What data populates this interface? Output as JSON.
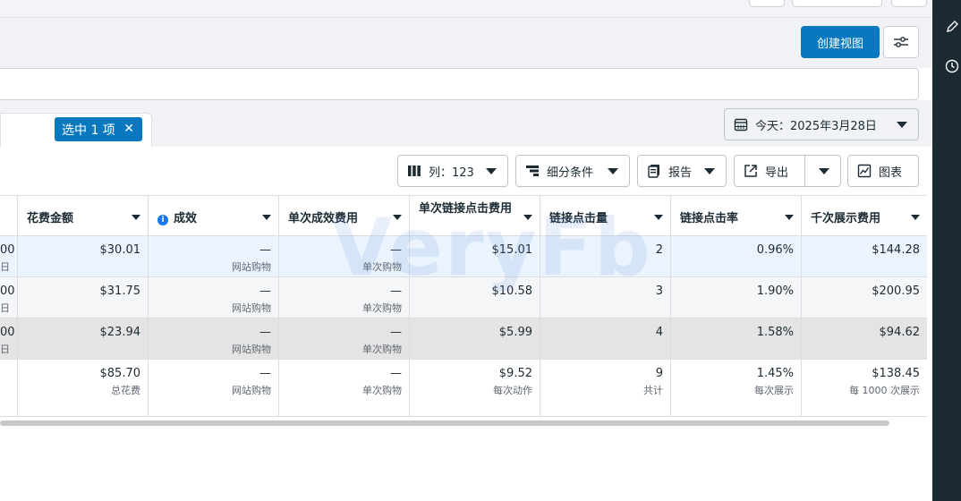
{
  "toolbar": {
    "create_view_label": "创建视图",
    "selection_label": "选中 1 项",
    "date_label": "今天：2025年3月28日",
    "columns_label": "列：123",
    "breakdown_label": "细分条件",
    "report_label": "报告",
    "export_label": "导出",
    "chart_label": "图表"
  },
  "table": {
    "headers": [
      {
        "label": "花费金额"
      },
      {
        "label": "成效"
      },
      {
        "label": "单次成效费用"
      },
      {
        "label": "单次链接点击费用"
      },
      {
        "label": "链接点击量"
      },
      {
        "label": "链接点击率"
      },
      {
        "label": "千次展示费用"
      }
    ],
    "rows": [
      {
        "edge_value": "00",
        "edge_sub": "日",
        "cells": [
          {
            "v": "$30.01",
            "s": ""
          },
          {
            "v": "—",
            "s": "网站购物"
          },
          {
            "v": "—",
            "s": "单次购物"
          },
          {
            "v": "$15.01",
            "s": ""
          },
          {
            "v": "2",
            "s": ""
          },
          {
            "v": "0.96%",
            "s": ""
          },
          {
            "v": "$144.28",
            "s": ""
          }
        ]
      },
      {
        "edge_value": "00",
        "edge_sub": "日",
        "cells": [
          {
            "v": "$31.75",
            "s": ""
          },
          {
            "v": "—",
            "s": "网站购物"
          },
          {
            "v": "—",
            "s": "单次购物"
          },
          {
            "v": "$10.58",
            "s": ""
          },
          {
            "v": "3",
            "s": ""
          },
          {
            "v": "1.90%",
            "s": ""
          },
          {
            "v": "$200.95",
            "s": ""
          }
        ]
      },
      {
        "edge_value": "00",
        "edge_sub": "日",
        "cells": [
          {
            "v": "$23.94",
            "s": ""
          },
          {
            "v": "—",
            "s": "网站购物"
          },
          {
            "v": "—",
            "s": "单次购物"
          },
          {
            "v": "$5.99",
            "s": ""
          },
          {
            "v": "4",
            "s": ""
          },
          {
            "v": "1.58%",
            "s": ""
          },
          {
            "v": "$94.62",
            "s": ""
          }
        ]
      }
    ],
    "summary": [
      {
        "v": "$85.70",
        "s": "总花费"
      },
      {
        "v": "—",
        "s": "网站购物"
      },
      {
        "v": "—",
        "s": "单次购物"
      },
      {
        "v": "$9.52",
        "s": "每次动作"
      },
      {
        "v": "9",
        "s": "共计"
      },
      {
        "v": "1.45%",
        "s": "每次展示"
      },
      {
        "v": "$138.45",
        "s": "每 1000 次展示"
      }
    ]
  },
  "watermark": "VeryFb",
  "colors": {
    "primary": "#0a78be",
    "row_selected": "#ebf3fd",
    "row_alt": "#f5f6f7",
    "row_hover": "#e4e4e4",
    "panel_dark": "#1c2a33"
  }
}
